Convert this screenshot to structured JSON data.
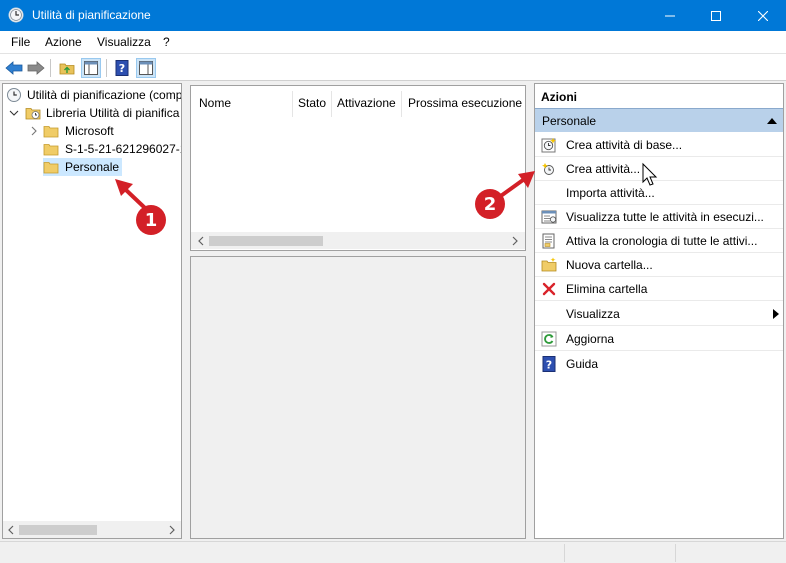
{
  "window": {
    "title": "Utilità di pianificazione",
    "icon": "clock-icon"
  },
  "menu": [
    "File",
    "Azione",
    "Visualizza",
    "?"
  ],
  "tree": {
    "root": "Utilità di pianificazione (comp",
    "library": "Libreria Utilità di pianifica",
    "children": [
      "Microsoft",
      "S-1-5-21-621296027-1",
      "Personale"
    ],
    "selected": "Personale"
  },
  "list": {
    "columns": [
      "Nome",
      "Stato",
      "Attivazione",
      "Prossima esecuzione"
    ]
  },
  "actions": {
    "title": "Azioni",
    "group": "Personale",
    "items": [
      {
        "label": "Crea attività di base...",
        "icon": "basic-task-icon"
      },
      {
        "label": "Crea attività...",
        "icon": "create-task-icon"
      },
      {
        "label": "Importa attività...",
        "icon": ""
      },
      {
        "label": "Visualizza tutte le attività in esecuzi...",
        "icon": "running-tasks-icon"
      },
      {
        "label": "Attiva la cronologia di tutte le attivi...",
        "icon": "history-icon"
      },
      {
        "label": "Nuova cartella...",
        "icon": "new-folder-icon"
      },
      {
        "label": "Elimina cartella",
        "icon": "delete-icon"
      },
      {
        "label": "Visualizza",
        "icon": "",
        "submenu": true
      },
      {
        "label": "Aggiorna",
        "icon": "refresh-icon"
      },
      {
        "label": "Guida",
        "icon": "help-icon"
      }
    ]
  },
  "annotations": {
    "badge1": "1",
    "badge2": "2",
    "color": "#d32027"
  },
  "colors": {
    "titlebar": "#0078d7",
    "selection": "#cce8ff",
    "group_header": "#b9d1ea"
  }
}
